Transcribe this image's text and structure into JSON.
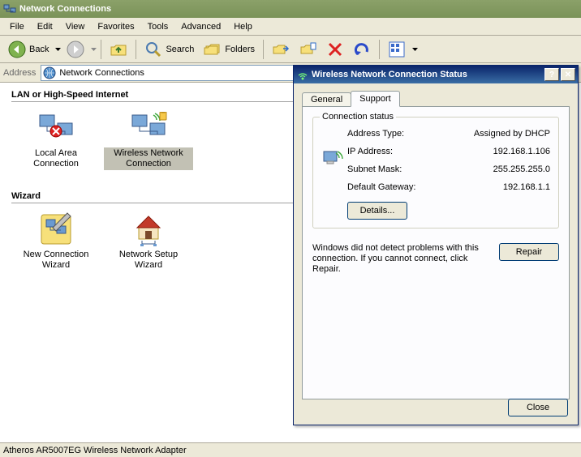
{
  "window": {
    "title": "Network Connections"
  },
  "menu": {
    "file": "File",
    "edit": "Edit",
    "view": "View",
    "favorites": "Favorites",
    "tools": "Tools",
    "advanced": "Advanced",
    "help": "Help"
  },
  "toolbar": {
    "back": "Back",
    "search": "Search",
    "folders": "Folders"
  },
  "address": {
    "label": "Address",
    "value": "Network Connections"
  },
  "groups": {
    "lan": {
      "header": "LAN or High-Speed Internet",
      "items": [
        {
          "line1": "Local Area",
          "line2": "Connection"
        },
        {
          "line1": "Wireless Network",
          "line2": "Connection"
        }
      ]
    },
    "wizard": {
      "header": "Wizard",
      "items": [
        {
          "line1": "New Connection",
          "line2": "Wizard"
        },
        {
          "line1": "Network Setup",
          "line2": "Wizard"
        }
      ]
    }
  },
  "statusbar": {
    "text": "Atheros AR5007EG Wireless Network Adapter"
  },
  "dialog": {
    "title": "Wireless Network Connection Status",
    "tabs": {
      "general": "General",
      "support": "Support"
    },
    "groupbox_legend": "Connection status",
    "rows": {
      "address_type_label": "Address Type:",
      "address_type_value": "Assigned by DHCP",
      "ip_label": "IP Address:",
      "ip_value": "192.168.1.106",
      "subnet_label": "Subnet Mask:",
      "subnet_value": "255.255.255.0",
      "gateway_label": "Default Gateway:",
      "gateway_value": "192.168.1.1"
    },
    "details_btn": "Details...",
    "repair_text": "Windows did not detect problems with this connection. If you cannot connect, click Repair.",
    "repair_btn": "Repair",
    "close_btn": "Close"
  }
}
